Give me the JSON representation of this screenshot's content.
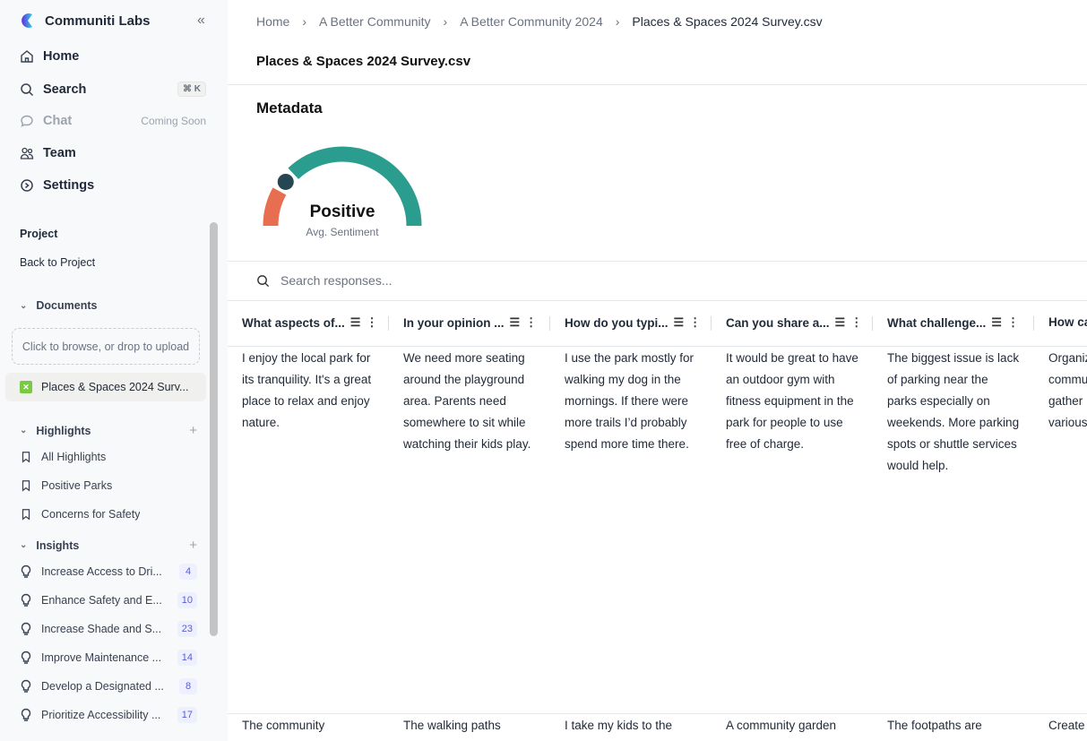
{
  "sidebar": {
    "brand": "Communiti Labs",
    "nav": [
      {
        "label": "Home",
        "icon": "home-icon"
      },
      {
        "label": "Search",
        "icon": "search-icon",
        "shortcut": "⌘ K"
      },
      {
        "label": "Chat",
        "icon": "chat-icon",
        "note": "Coming Soon"
      },
      {
        "label": "Team",
        "icon": "team-icon"
      },
      {
        "label": "Settings",
        "icon": "settings-icon"
      }
    ],
    "project_label": "Project",
    "back_label": "Back to Project",
    "documents_label": "Documents",
    "upload_placeholder": "Click to browse, or drop to upload",
    "document": "Places & Spaces 2024 Surv...",
    "highlights_label": "Highlights",
    "highlights": [
      "All Highlights",
      "Positive Parks",
      "Concerns for Safety"
    ],
    "insights_label": "Insights",
    "insights": [
      {
        "label": "Increase Access to Dri...",
        "count": "4"
      },
      {
        "label": "Enhance Safety and E...",
        "count": "10"
      },
      {
        "label": "Increase Shade and S...",
        "count": "23"
      },
      {
        "label": "Improve Maintenance ...",
        "count": "14"
      },
      {
        "label": "Develop a Designated ...",
        "count": "8"
      },
      {
        "label": "Prioritize Accessibility ...",
        "count": "17"
      }
    ]
  },
  "breadcrumb": [
    "Home",
    "A Better Community",
    "A Better Community 2024",
    "Places & Spaces 2024 Survey.csv"
  ],
  "page_title": "Places & Spaces 2024 Survey.csv",
  "metadata": {
    "heading": "Metadata",
    "sentiment": "Positive",
    "sentiment_label": "Avg. Sentiment",
    "gauge_marker": 0.21,
    "colors": {
      "negative": "#e86e52",
      "positive": "#2a9d8f",
      "marker": "#264653"
    }
  },
  "search_placeholder": "Search responses...",
  "table": {
    "columns": [
      "What aspects of...",
      "In your opinion ...",
      "How do you typi...",
      "Can you share a...",
      "What challenge...",
      "How ca"
    ],
    "rows": [
      [
        "I enjoy the local park for its tranquility. It's a great place to relax and enjoy nature.",
        "We need more seating around the playground area. Parents need somewhere to sit while watching their kids play.",
        "I use the park mostly for walking my dog in the mornings. If there were more trails I’d probably spend more time there.",
        "It would be great to have an outdoor gym with fitness equipment in the park for people to use free of charge.",
        "The biggest issue is lack of parking near the parks especially on weekends. More parking spots or shuttle services would help.",
        "Organiz commu gather various"
      ],
      [
        "The community",
        "The walking paths",
        "I take my kids to the",
        "A community garden",
        "The footpaths are",
        "Create"
      ]
    ]
  }
}
